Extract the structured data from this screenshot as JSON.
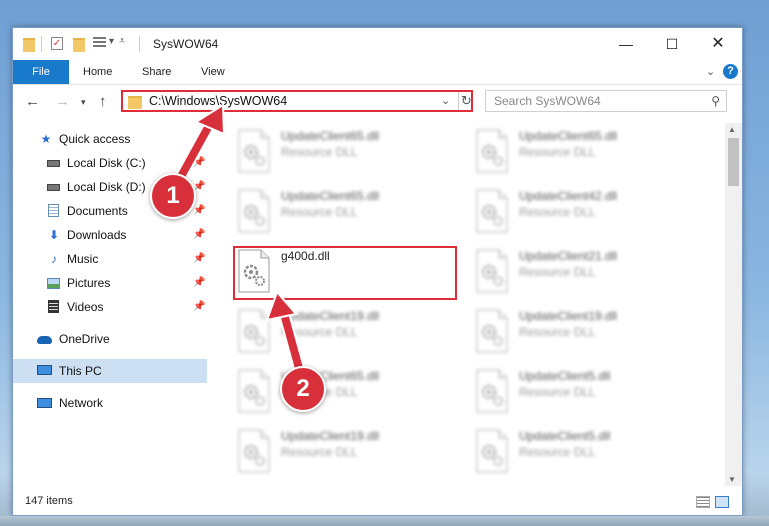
{
  "window": {
    "title": "SysWOW64"
  },
  "ribbon": {
    "file": "File",
    "tabs": [
      "Home",
      "Share",
      "View"
    ],
    "help": "?"
  },
  "address": {
    "path": "C:\\Windows\\SysWOW64",
    "search_placeholder": "Search SysWOW64"
  },
  "nav_pane": {
    "items": [
      {
        "label": "Quick access",
        "icon": "star-icon",
        "pinned": false,
        "selected": false
      },
      {
        "label": "Local Disk (C:)",
        "icon": "drive-icon",
        "pinned": true,
        "selected": false
      },
      {
        "label": "Local Disk (D:)",
        "icon": "drive-icon",
        "pinned": true,
        "selected": false
      },
      {
        "label": "Documents",
        "icon": "documents-icon",
        "pinned": true,
        "selected": false
      },
      {
        "label": "Downloads",
        "icon": "downloads-icon",
        "pinned": true,
        "selected": false
      },
      {
        "label": "Music",
        "icon": "music-icon",
        "pinned": true,
        "selected": false
      },
      {
        "label": "Pictures",
        "icon": "pictures-icon",
        "pinned": true,
        "selected": false
      },
      {
        "label": "Videos",
        "icon": "videos-icon",
        "pinned": true,
        "selected": false
      },
      {
        "label": "OneDrive",
        "icon": "onedrive-icon",
        "pinned": false,
        "selected": false
      },
      {
        "label": "This PC",
        "icon": "this-pc-icon",
        "pinned": false,
        "selected": true
      },
      {
        "label": "Network",
        "icon": "network-icon",
        "pinned": false,
        "selected": false
      }
    ]
  },
  "files": [
    {
      "name": "UpdateClient65.dll",
      "type": "Resource DLL",
      "blurred": true
    },
    {
      "name": "UpdateClient65.dll",
      "type": "Resource DLL",
      "blurred": true
    },
    {
      "name": "UpdateClient65.dll",
      "type": "Resource DLL",
      "blurred": true
    },
    {
      "name": "UpdateClient42.dll",
      "type": "Resource DLL",
      "blurred": true
    },
    {
      "name": "g400d.dll",
      "type": "",
      "blurred": false
    },
    {
      "name": "UpdateClient21.dll",
      "type": "Resource DLL",
      "blurred": true
    },
    {
      "name": "UpdateClient19.dll",
      "type": "Resource DLL",
      "blurred": true
    },
    {
      "name": "UpdateClient19.dll",
      "type": "Resource DLL",
      "blurred": true
    },
    {
      "name": "UpdateClient65.dll",
      "type": "Resource DLL",
      "blurred": true
    },
    {
      "name": "UpdateClient5.dll",
      "type": "Resource DLL",
      "blurred": true
    },
    {
      "name": "UpdateClient19.dll",
      "type": "Resource DLL",
      "blurred": true
    },
    {
      "name": "UpdateClient5.dll",
      "type": "Resource DLL",
      "blurred": true
    }
  ],
  "status": {
    "count": "147 items"
  },
  "annotations": {
    "step1": "1",
    "step2": "2"
  },
  "colors": {
    "accent": "#1979ca",
    "highlight": "#e02d3a",
    "selection": "#cde0f3"
  }
}
